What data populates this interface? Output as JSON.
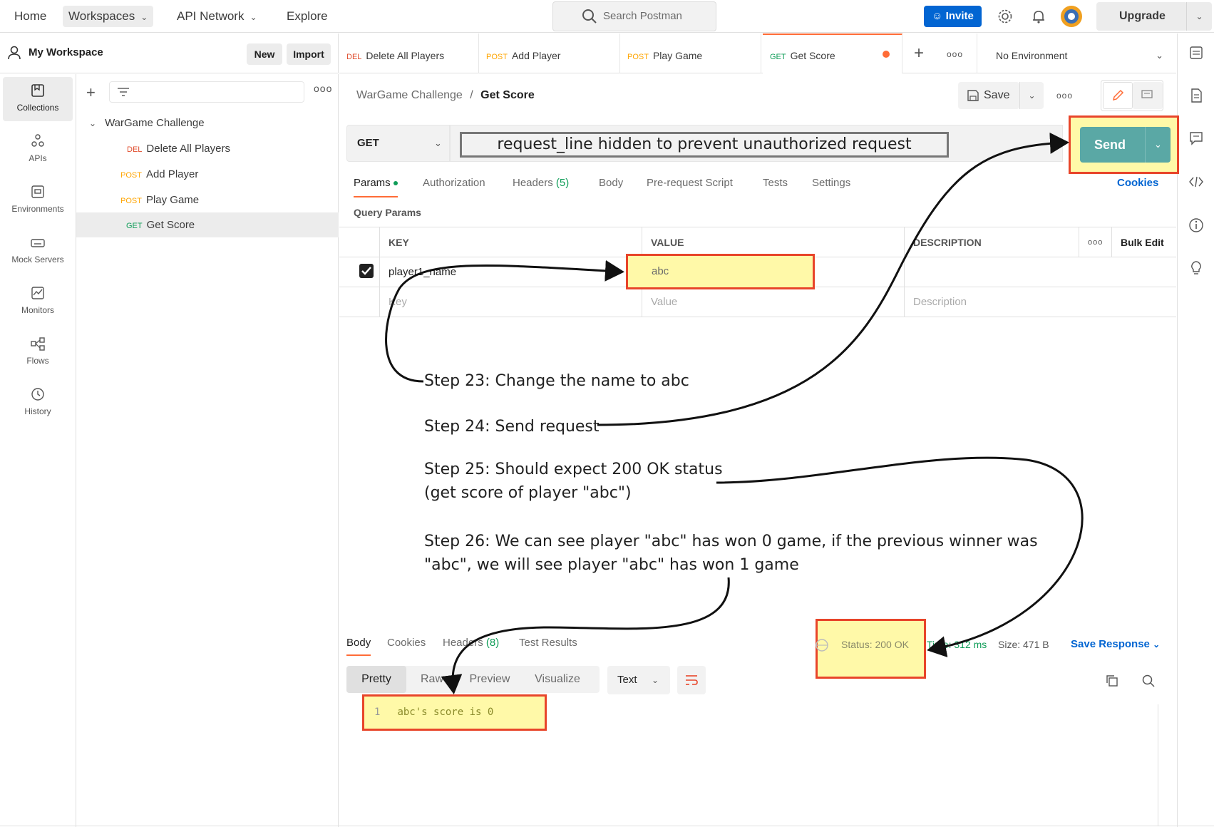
{
  "topnav": {
    "home": "Home",
    "workspaces": "Workspaces",
    "api_network": "API Network",
    "explore": "Explore",
    "search_placeholder": "Search Postman",
    "invite": "Invite",
    "upgrade": "Upgrade"
  },
  "workspace": {
    "title": "My Workspace",
    "new": "New",
    "import": "Import"
  },
  "rail": {
    "items": [
      {
        "label": "Collections",
        "icon": "collections-icon"
      },
      {
        "label": "APIs",
        "icon": "apis-icon"
      },
      {
        "label": "Environments",
        "icon": "environments-icon"
      },
      {
        "label": "Mock Servers",
        "icon": "mock-servers-icon"
      },
      {
        "label": "Monitors",
        "icon": "monitors-icon"
      },
      {
        "label": "Flows",
        "icon": "flows-icon"
      },
      {
        "label": "History",
        "icon": "history-icon"
      }
    ]
  },
  "tree": {
    "collection": "WarGame Challenge",
    "items": [
      {
        "method": "DEL",
        "name": "Delete All Players"
      },
      {
        "method": "POST",
        "name": "Add Player"
      },
      {
        "method": "POST",
        "name": "Play Game"
      },
      {
        "method": "GET",
        "name": "Get Score"
      }
    ]
  },
  "tabs": [
    {
      "method": "DEL",
      "name": "Delete All Players"
    },
    {
      "method": "POST",
      "name": "Add Player"
    },
    {
      "method": "POST",
      "name": "Play Game"
    },
    {
      "method": "GET",
      "name": "Get Score"
    }
  ],
  "environment": "No Environment",
  "breadcrumb": {
    "collection": "WarGame Challenge",
    "sep": "/",
    "request": "Get Score"
  },
  "save": "Save",
  "request": {
    "method": "GET",
    "url_notice": "request_line hidden to prevent unauthorized request",
    "send": "Send"
  },
  "request_tabs": {
    "params": "Params",
    "authorization": "Authorization",
    "headers": "Headers",
    "headers_count": "(5)",
    "body": "Body",
    "pre_request": "Pre-request Script",
    "tests": "Tests",
    "settings": "Settings",
    "cookies": "Cookies"
  },
  "query_params": {
    "label": "Query Params",
    "headers": {
      "key": "KEY",
      "value": "VALUE",
      "description": "DESCRIPTION",
      "bulk_edit": "Bulk Edit"
    },
    "rows": [
      {
        "key": "player1_name",
        "value": "abc",
        "description": ""
      }
    ],
    "placeholders": {
      "key": "Key",
      "value": "Value",
      "description": "Description"
    }
  },
  "annotations": {
    "step23": "Step 23: Change the name to abc",
    "step24": "Step 24: Send request",
    "step25_line1": "Step 25: Should expect 200 OK status",
    "step25_line2": "(get score of player \"abc\")",
    "step26_line1": "Step 26: We can see player \"abc\" has won 0 game, if the previous winner was",
    "step26_line2": "\"abc\", we will see player \"abc\" has won 1 game"
  },
  "response": {
    "tabs": {
      "body": "Body",
      "cookies": "Cookies",
      "headers": "Headers",
      "headers_count": "(8)",
      "test_results": "Test Results"
    },
    "status": "Status: 200 OK",
    "time": "Time: 312 ms",
    "size": "Size: 471 B",
    "save_response": "Save Response",
    "formats": [
      "Pretty",
      "Raw",
      "Preview",
      "Visualize"
    ],
    "language": "Text",
    "line_number": "1",
    "body_text": "abc's score is 0"
  },
  "colors": {
    "accent_orange": "#ff6c37",
    "brand_blue": "#0265d2",
    "send_teal": "#5aa8a5",
    "highlight_yellow": "#fff9a8",
    "highlight_border": "#e8452a"
  }
}
